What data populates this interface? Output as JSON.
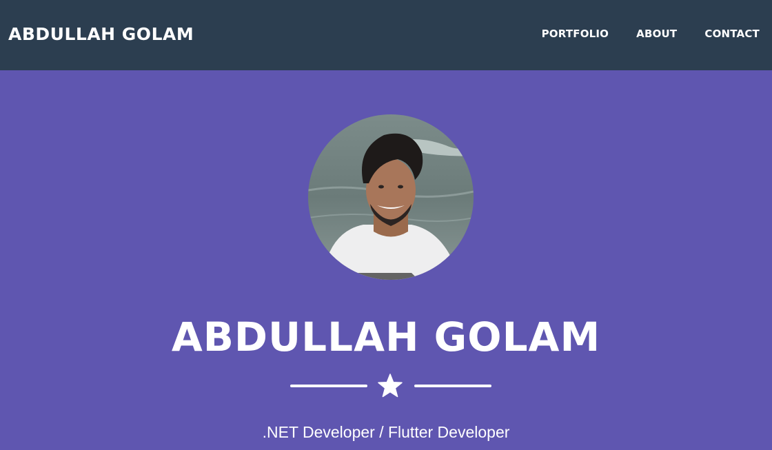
{
  "navbar": {
    "brand": "ABDULLAH GOLAM",
    "links": [
      {
        "label": "PORTFOLIO"
      },
      {
        "label": "ABOUT"
      },
      {
        "label": "CONTACT"
      }
    ],
    "background_color": "#2c3e50"
  },
  "masthead": {
    "background_color": "#5f56b0",
    "avatar_icon": "profile-photo",
    "title": "ABDULLAH GOLAM",
    "divider_icon": "star-icon",
    "subtitle": ".NET Developer / Flutter Developer"
  }
}
